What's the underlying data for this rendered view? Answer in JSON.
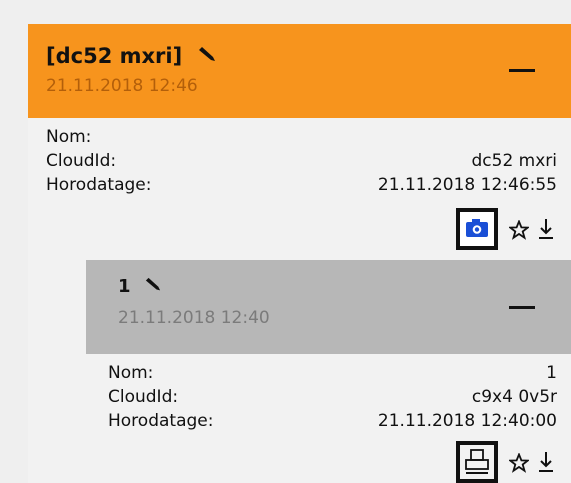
{
  "device": {
    "title": "[dc52 mxri]",
    "datetime": "21.11.2018 12:46",
    "fields": [
      {
        "label": "Nom:",
        "value": ""
      },
      {
        "label": "CloudId:",
        "value": "dc52 mxri"
      },
      {
        "label": "Horodatage:",
        "value": "21.11.2018 12:46:55"
      }
    ],
    "actions": {
      "primary_icon": "camera-icon",
      "favorite_icon": "star-icon",
      "download_icon": "download-icon"
    }
  },
  "sub_item": {
    "title": "1",
    "datetime": "21.11.2018 12:40",
    "fields": [
      {
        "label": "Nom:",
        "value": "1"
      },
      {
        "label": "CloudId:",
        "value": "c9x4 0v5r"
      },
      {
        "label": "Horodatage:",
        "value": "21.11.2018 12:40:00"
      }
    ],
    "actions": {
      "primary_icon": "print-icon",
      "favorite_icon": "star-icon",
      "download_icon": "download-icon"
    }
  },
  "colors": {
    "header_orange": "#f7941d",
    "header_time_orange": "#b35f0a",
    "sub_header_gray": "#b7b7b7",
    "camera_blue": "#1a4fd6"
  }
}
